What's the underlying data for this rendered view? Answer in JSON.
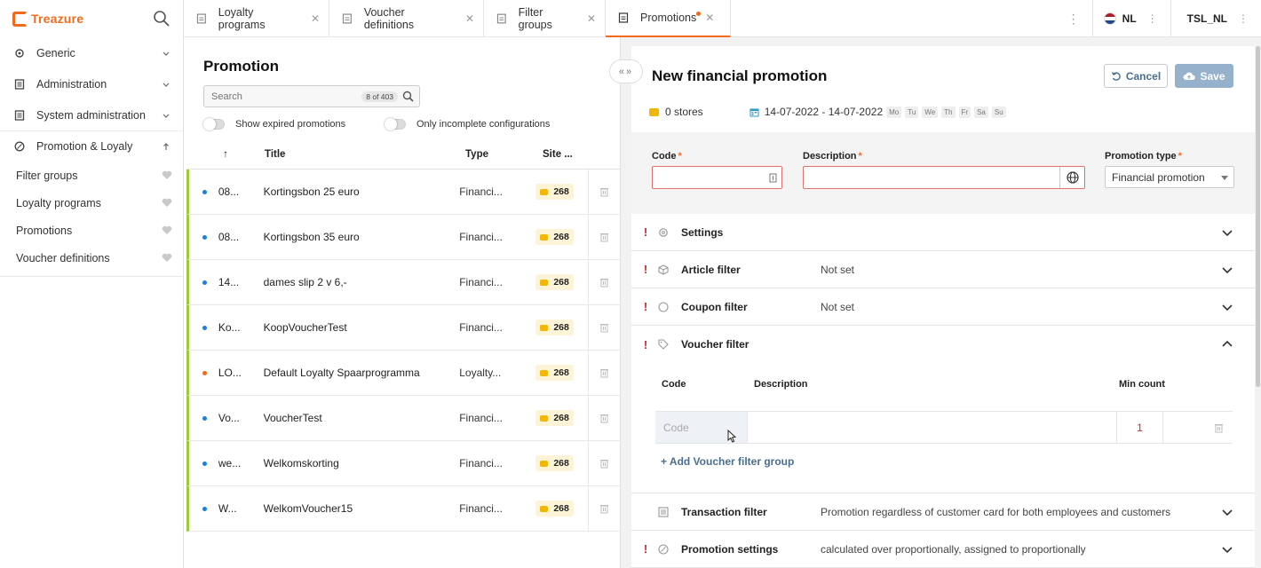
{
  "brand": {
    "name": "Treazure"
  },
  "sidebar": {
    "items": [
      {
        "label": "Generic",
        "icon": "gear-icon"
      },
      {
        "label": "Administration",
        "icon": "document-icon"
      },
      {
        "label": "System administration",
        "icon": "document-icon"
      },
      {
        "label": "Promotion & Loyaly",
        "icon": "promo-icon"
      }
    ],
    "subitems": [
      {
        "label": "Filter groups"
      },
      {
        "label": "Loyalty programs"
      },
      {
        "label": "Promotions"
      },
      {
        "label": "Voucher definitions"
      }
    ]
  },
  "tabs": [
    {
      "label": "Loyalty programs"
    },
    {
      "label": "Voucher definitions"
    },
    {
      "label": "Filter groups"
    },
    {
      "label": "Promotions",
      "active": true,
      "unsaved": true
    }
  ],
  "header": {
    "language": "NL",
    "tenant": "TSL_NL"
  },
  "list": {
    "title": "Promotion",
    "search": {
      "placeholder": "Search",
      "count": "8 of 403"
    },
    "toggles": {
      "expired": "Show expired promotions",
      "incomplete": "Only incomplete configurations"
    },
    "columns": {
      "sort": "↑",
      "title": "Title",
      "type": "Type",
      "site": "Site ..."
    },
    "rows": [
      {
        "code": "08...",
        "title": "Kortingsbon 25 euro",
        "type": "Financi...",
        "site": "268",
        "dot": "#1f7fd1"
      },
      {
        "code": "08...",
        "title": "Kortingsbon 35 euro",
        "type": "Financi...",
        "site": "268",
        "dot": "#1f7fd1"
      },
      {
        "code": "14...",
        "title": "dames slip 2 v 6,-",
        "type": "Financi...",
        "site": "268",
        "dot": "#1f7fd1"
      },
      {
        "code": "Ko...",
        "title": "KoopVoucherTest",
        "type": "Financi...",
        "site": "268",
        "dot": "#1f7fd1"
      },
      {
        "code": "LO...",
        "title": "Default Loyalty Spaarprogramma",
        "type": "Loyalty...",
        "site": "268",
        "dot": "#f26b1d"
      },
      {
        "code": "Vo...",
        "title": "VoucherTest",
        "type": "Financi...",
        "site": "268",
        "dot": "#1f7fd1"
      },
      {
        "code": "we...",
        "title": "Welkomskorting",
        "type": "Financi...",
        "site": "268",
        "dot": "#1f7fd1"
      },
      {
        "code": "W...",
        "title": "WelkomVoucher15",
        "type": "Financi...",
        "site": "268",
        "dot": "#1f7fd1"
      }
    ]
  },
  "detail": {
    "title": "New financial promotion",
    "cancel": "Cancel",
    "save": "Save",
    "stores": "0 stores",
    "dates": "14-07-2022 - 14-07-2022",
    "days": [
      "Mo",
      "Tu",
      "We",
      "Th",
      "Fr",
      "Sa",
      "Su"
    ],
    "fields": {
      "code_label": "Code",
      "desc_label": "Description",
      "type_label": "Promotion type",
      "required": "*",
      "type_value": "Financial promotion"
    },
    "sections": [
      {
        "title": "Settings",
        "value": "",
        "warn": "!",
        "icon": "gear-icon"
      },
      {
        "title": "Article filter",
        "value": "Not set",
        "warn": "!",
        "icon": "cube-icon"
      },
      {
        "title": "Coupon filter",
        "value": "Not set",
        "warn": "!",
        "icon": "circle-icon"
      },
      {
        "title": "Voucher filter",
        "value": "",
        "warn": "!",
        "icon": "tag-icon"
      }
    ],
    "voucher_filter": {
      "col_code": "Code",
      "col_desc": "Description",
      "col_min": "Min count",
      "code_placeholder": "Code",
      "min_value": "1",
      "add_label": "+ Add Voucher filter group"
    },
    "sections_bottom": [
      {
        "title": "Transaction filter",
        "value": "Promotion regardless of customer card for both employees and customers",
        "warn": "",
        "icon": "list-icon"
      },
      {
        "title": "Promotion settings",
        "value": "calculated over proportionally, assigned to proportionally",
        "warn": "!",
        "icon": "percent-icon"
      }
    ]
  },
  "colors": {
    "accent": "#f26b1d",
    "link": "#4a6e92",
    "error": "#d0242b",
    "row_marker": "#9ccb3c",
    "coin": "#f2b705"
  }
}
